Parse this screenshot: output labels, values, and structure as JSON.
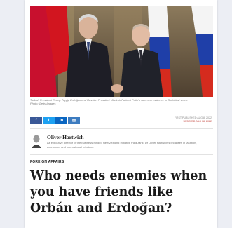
{
  "photo": {
    "caption": "Turkish President Recep Tayyip Erdoğan and Russian President Vladimir Putin at Putin's summer residence in Sochi last week. Photo: Getty Images"
  },
  "share": {
    "buttons": [
      {
        "icon": "facebook-icon",
        "label": "f",
        "color": "#3b5998"
      },
      {
        "icon": "twitter-icon",
        "label": "t",
        "color": "#1da1f2"
      },
      {
        "icon": "linkedin-icon",
        "label": "in",
        "color": "#0a66c2"
      },
      {
        "icon": "email-icon",
        "label": "✉",
        "color": "#3d7cc0"
      }
    ]
  },
  "meta": {
    "published": "First published Aug 8, 2022",
    "updated": "Updated Aug 08, 2022"
  },
  "author": {
    "name": "Oliver Hartwich",
    "bio": "As executive director of the business-funded New Zealand Initiative think-tank, Dr Oliver Hartwich specialises in taxation, economics and international relations."
  },
  "article": {
    "section": "FOREIGN AFFAIRS",
    "headline": "Who needs enemies when you have friends like Orbán and Erdoğan?"
  }
}
